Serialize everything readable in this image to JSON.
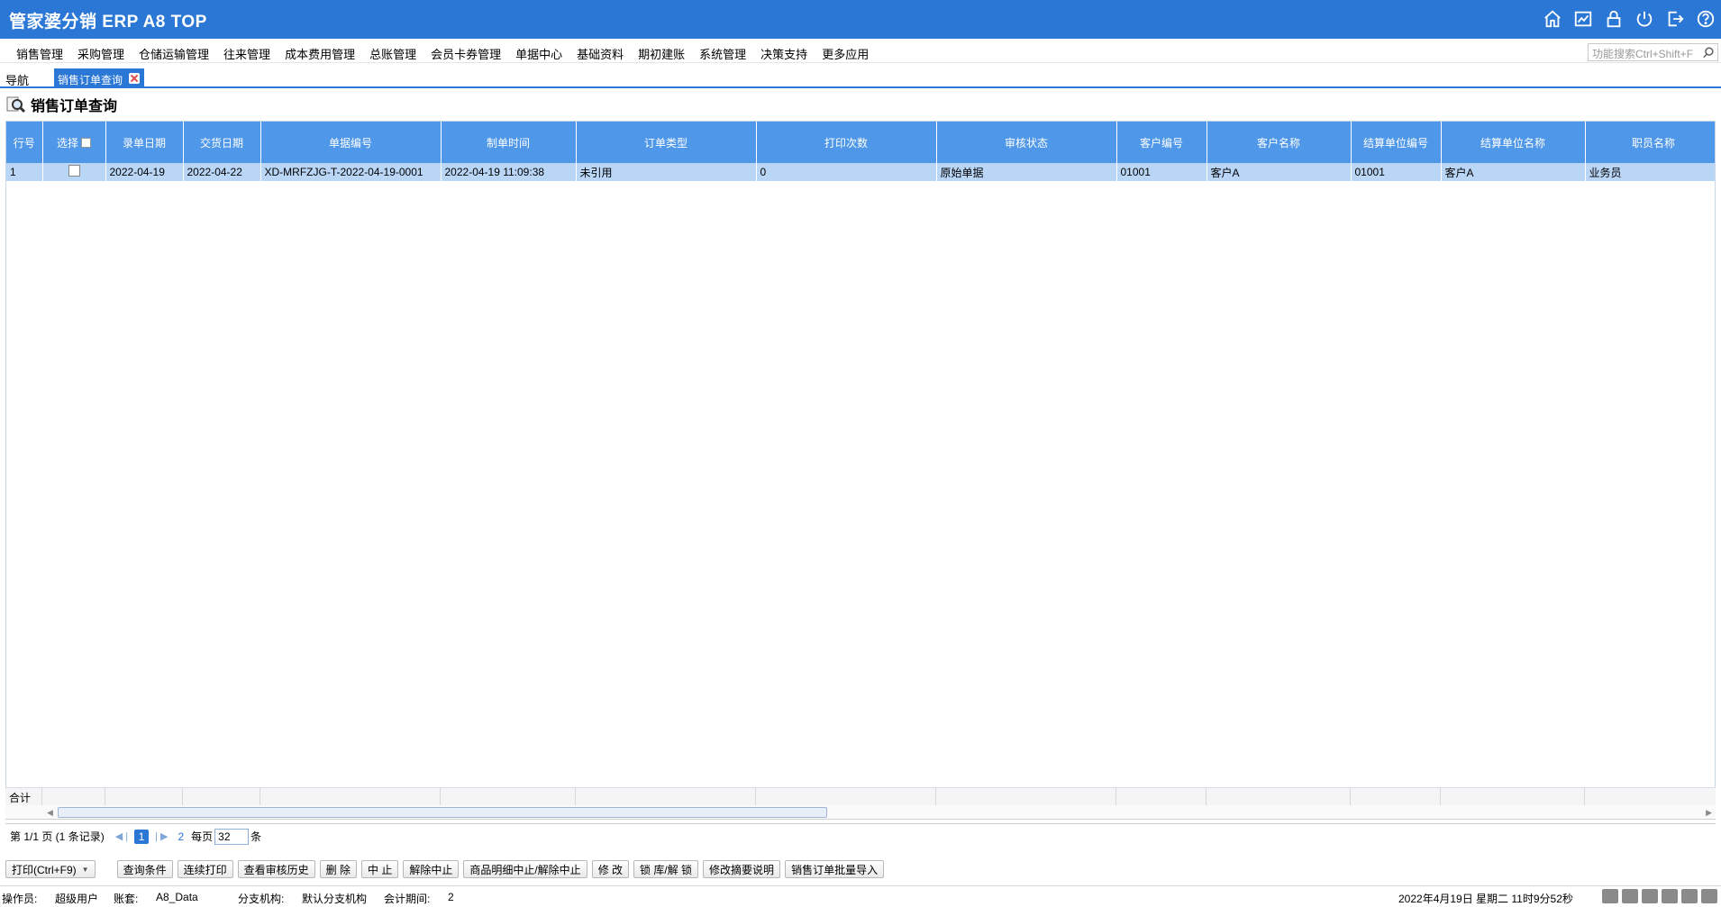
{
  "app": {
    "title": "管家婆分销 ERP A8 TOP"
  },
  "title_icons": [
    "home-icon",
    "chart-icon",
    "lock-icon",
    "power-icon",
    "exit-icon",
    "help-icon"
  ],
  "menu": [
    "销售管理",
    "采购管理",
    "仓储运输管理",
    "往来管理",
    "成本费用管理",
    "总账管理",
    "会员卡券管理",
    "单据中心",
    "基础资料",
    "期初建账",
    "系统管理",
    "决策支持",
    "更多应用"
  ],
  "search": {
    "placeholder": "功能搜索Ctrl+Shift+F"
  },
  "tabs": {
    "nav": "导航",
    "active": "销售订单查询"
  },
  "page": {
    "title": "销售订单查询"
  },
  "table": {
    "columns": [
      "行号",
      "选择",
      "录单日期",
      "交货日期",
      "单据编号",
      "制单时间",
      "订单类型",
      "打印次数",
      "审核状态",
      "客户编号",
      "客户名称",
      "结算单位编号",
      "结算单位名称",
      "职员名称"
    ],
    "rows": [
      [
        "1",
        "",
        "2022-04-19",
        "2022-04-22",
        "XD-MRFZJG-T-2022-04-19-0001",
        "2022-04-19 11:09:38",
        "未引用",
        "0",
        "原始单据",
        "01001",
        "客户A",
        "01001",
        "客户A",
        "业务员"
      ]
    ],
    "summary_label": "合计"
  },
  "pager": {
    "info": "第 1/1 页 (1 条记录)",
    "current": "1",
    "next": "2",
    "per_page_label": "每页",
    "per_page": "32",
    "unit": "条"
  },
  "toolbar": [
    "查询条件",
    "连续打印",
    "查看审核历史",
    "删 除",
    "中 止",
    "解除中止",
    "商品明细中止/解除中止",
    "修 改",
    "锁 库/解 锁",
    "修改摘要说明",
    "销售订单批量导入"
  ],
  "print_button": "打印(Ctrl+F9)",
  "status": {
    "operator_label": "操作员:",
    "operator": "超级用户",
    "account_label": "账套:",
    "account": "A8_Data",
    "branch_label": "分支机构:",
    "branch": "默认分支机构",
    "period_label": "会计期间:",
    "period": "2",
    "datetime": "2022年4月19日  星期二  11时9分52秒"
  }
}
